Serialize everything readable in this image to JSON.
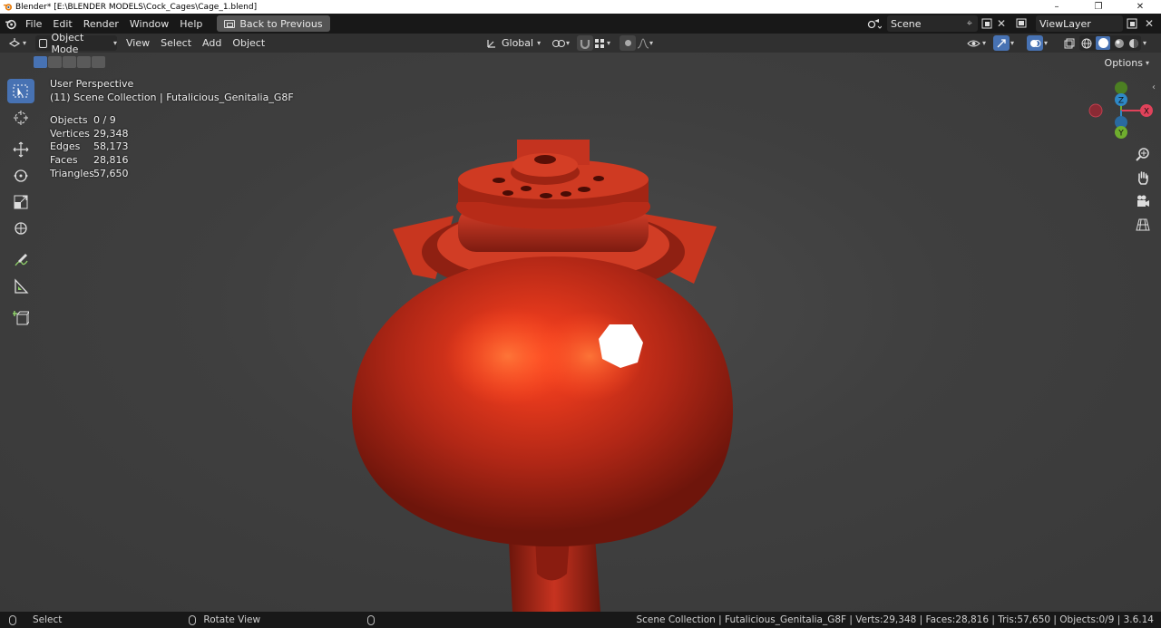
{
  "window": {
    "title": "Blender* [E:\\BLENDER MODELS\\Cock_Cages\\Cage_1.blend]",
    "minimize": "–",
    "maximize": "❐",
    "close": "✕"
  },
  "topbar": {
    "menus": [
      "File",
      "Edit",
      "Render",
      "Window",
      "Help"
    ],
    "back_button": "Back to Previous",
    "scene_name": "Scene",
    "view_layer": "ViewLayer"
  },
  "viewport_header": {
    "mode": "Object Mode",
    "menus": [
      "View",
      "Select",
      "Add",
      "Object"
    ],
    "transform_orientation": "Global",
    "options_label": "Options"
  },
  "overlay": {
    "perspective": "User Perspective",
    "collection": "(11) Scene Collection | Futalicious_Genitalia_G8F",
    "stats": [
      {
        "label": "Objects",
        "value": "0 / 9"
      },
      {
        "label": "Vertices",
        "value": "29,348"
      },
      {
        "label": "Edges",
        "value": "58,173"
      },
      {
        "label": "Faces",
        "value": "28,816"
      },
      {
        "label": "Triangles",
        "value": "57,650"
      }
    ]
  },
  "gizmo": {
    "z": "Z",
    "x": "X",
    "y": "Y"
  },
  "statusbar": {
    "select": "Select",
    "rotate": "Rotate View",
    "info": "Scene Collection | Futalicious_Genitalia_G8F | Verts:29,348 | Faces:28,816 | Tris:57,650 | Objects:0/9 | 3.6.14"
  },
  "colors": {
    "accent": "#4772b3",
    "model": "#c2301d",
    "axis_x": "#e0425a",
    "axis_y": "#6fae2e",
    "axis_z": "#2e88c6"
  }
}
